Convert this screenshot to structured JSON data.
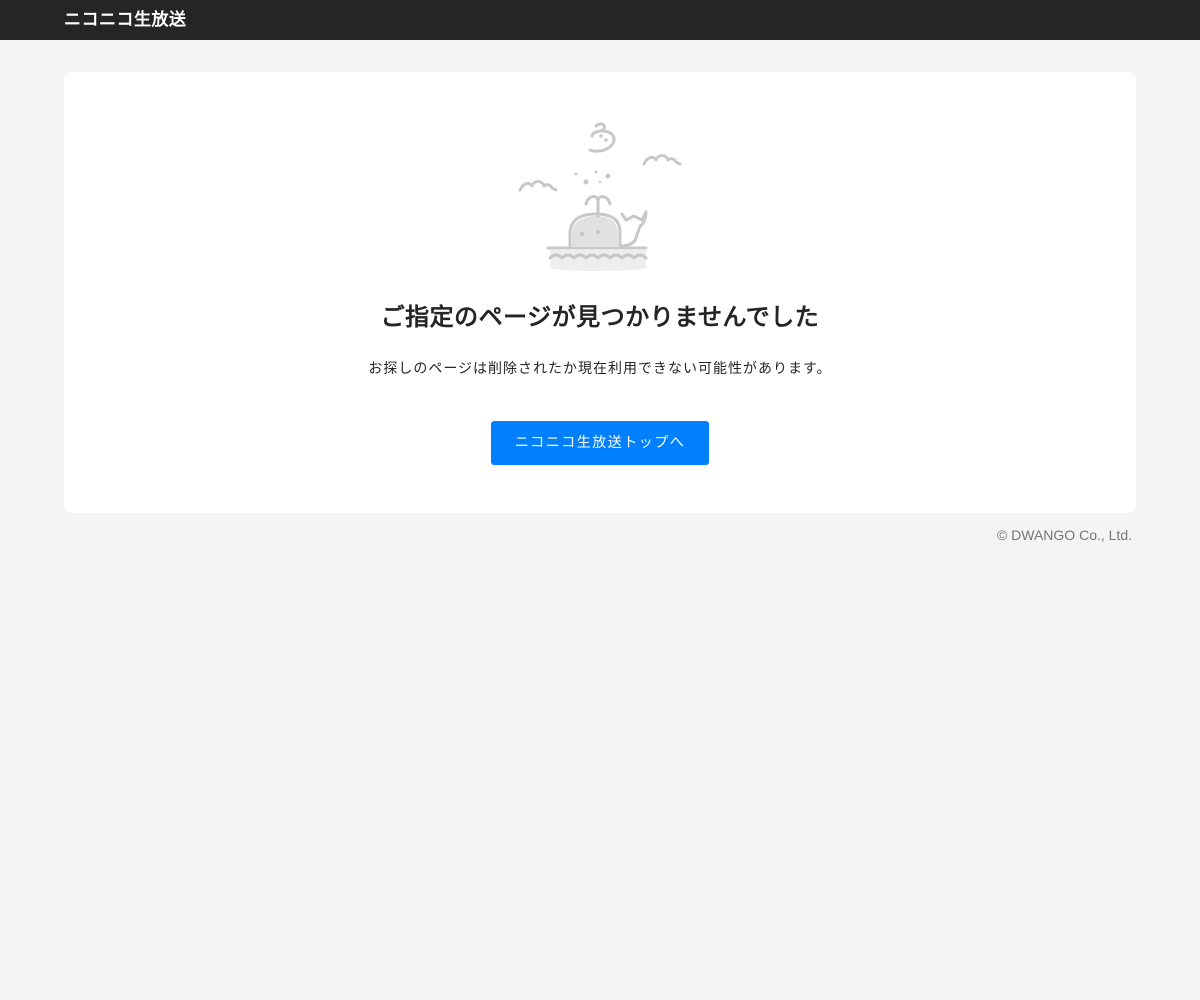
{
  "header": {
    "logo_text": "ニコニコ生放送"
  },
  "illustration": {
    "icon": "whale-illustration"
  },
  "error": {
    "title": "ご指定のページが見つかりませんでした",
    "description": "お探しのページは削除されたか現在利用できない可能性があります。"
  },
  "actions": {
    "top_button_label": "ニコニコ生放送トップへ"
  },
  "footer": {
    "copyright": "© DWANGO Co., Ltd."
  },
  "colors": {
    "header_bg": "#252525",
    "page_bg": "#f4f4f4",
    "card_bg": "#ffffff",
    "button_bg": "#0080ff",
    "illustration_gray": "#c8c8c8"
  }
}
